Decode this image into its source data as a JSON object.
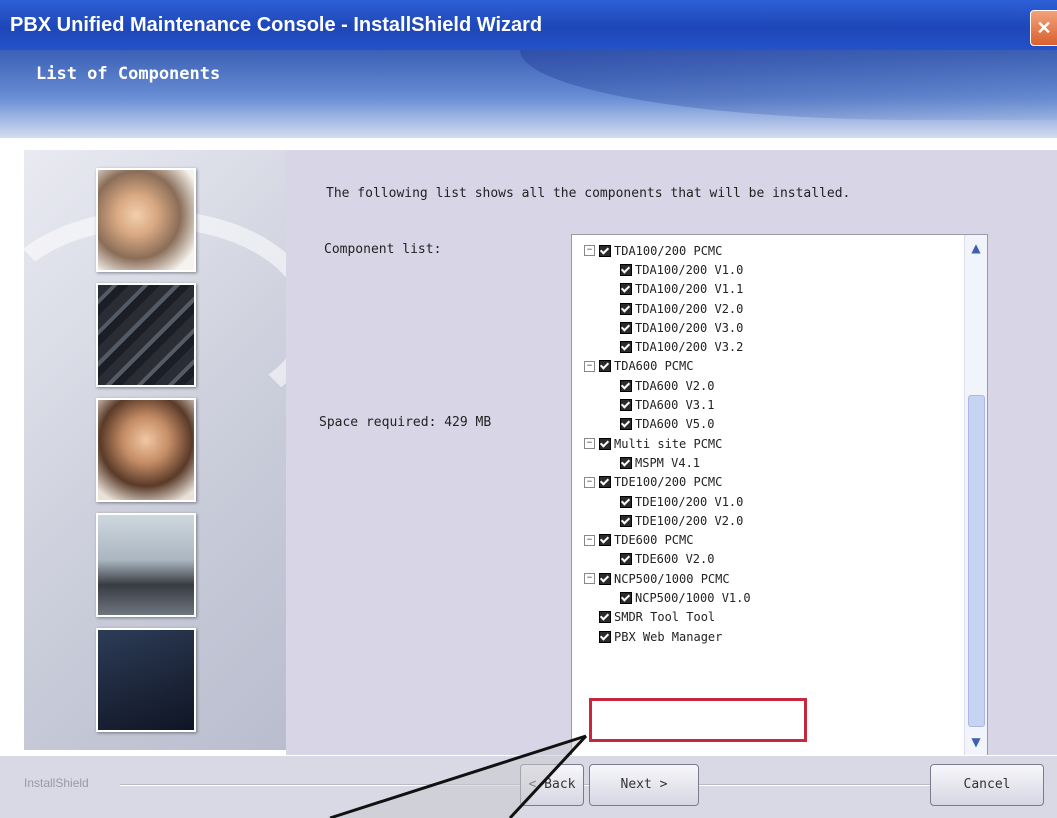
{
  "window": {
    "title": "PBX Unified Maintenance Console - InstallShield Wizard",
    "close_glyph": "✕"
  },
  "header": {
    "page_title": "List of Components"
  },
  "content": {
    "intro": "The following list shows all the components that will be installed.",
    "component_list_label": "Component list:",
    "space_required": "Space required: 429 MB"
  },
  "tree": {
    "items": [
      {
        "label": "TDA100/200 PCMC",
        "level": 0,
        "expander": "−"
      },
      {
        "label": "TDA100/200 V1.0",
        "level": 1
      },
      {
        "label": "TDA100/200 V1.1",
        "level": 1
      },
      {
        "label": "TDA100/200 V2.0",
        "level": 1
      },
      {
        "label": "TDA100/200 V3.0",
        "level": 1
      },
      {
        "label": "TDA100/200 V3.2",
        "level": 1
      },
      {
        "label": "TDA600 PCMC",
        "level": 0,
        "expander": "−"
      },
      {
        "label": "TDA600 V2.0",
        "level": 1
      },
      {
        "label": "TDA600 V3.1",
        "level": 1
      },
      {
        "label": "TDA600 V5.0",
        "level": 1
      },
      {
        "label": "Multi site PCMC",
        "level": 0,
        "expander": "−"
      },
      {
        "label": "MSPM V4.1",
        "level": 1
      },
      {
        "label": "TDE100/200 PCMC",
        "level": 0,
        "expander": "−"
      },
      {
        "label": "TDE100/200 V1.0",
        "level": 1
      },
      {
        "label": "TDE100/200 V2.0",
        "level": 1
      },
      {
        "label": "TDE600 PCMC",
        "level": 0,
        "expander": "−"
      },
      {
        "label": "TDE600 V2.0",
        "level": 1
      },
      {
        "label": "NCP500/1000 PCMC",
        "level": 0,
        "expander": "−"
      },
      {
        "label": "NCP500/1000 V1.0",
        "level": 1
      },
      {
        "label": "SMDR Tool Tool",
        "level": 0
      },
      {
        "label": "PBX Web Manager",
        "level": 0
      }
    ],
    "scroll_up": "▲",
    "scroll_down": "▼"
  },
  "footer": {
    "brand": "InstallShield",
    "back_label": "< Back",
    "next_label": "Next >",
    "cancel_label": "Cancel"
  }
}
